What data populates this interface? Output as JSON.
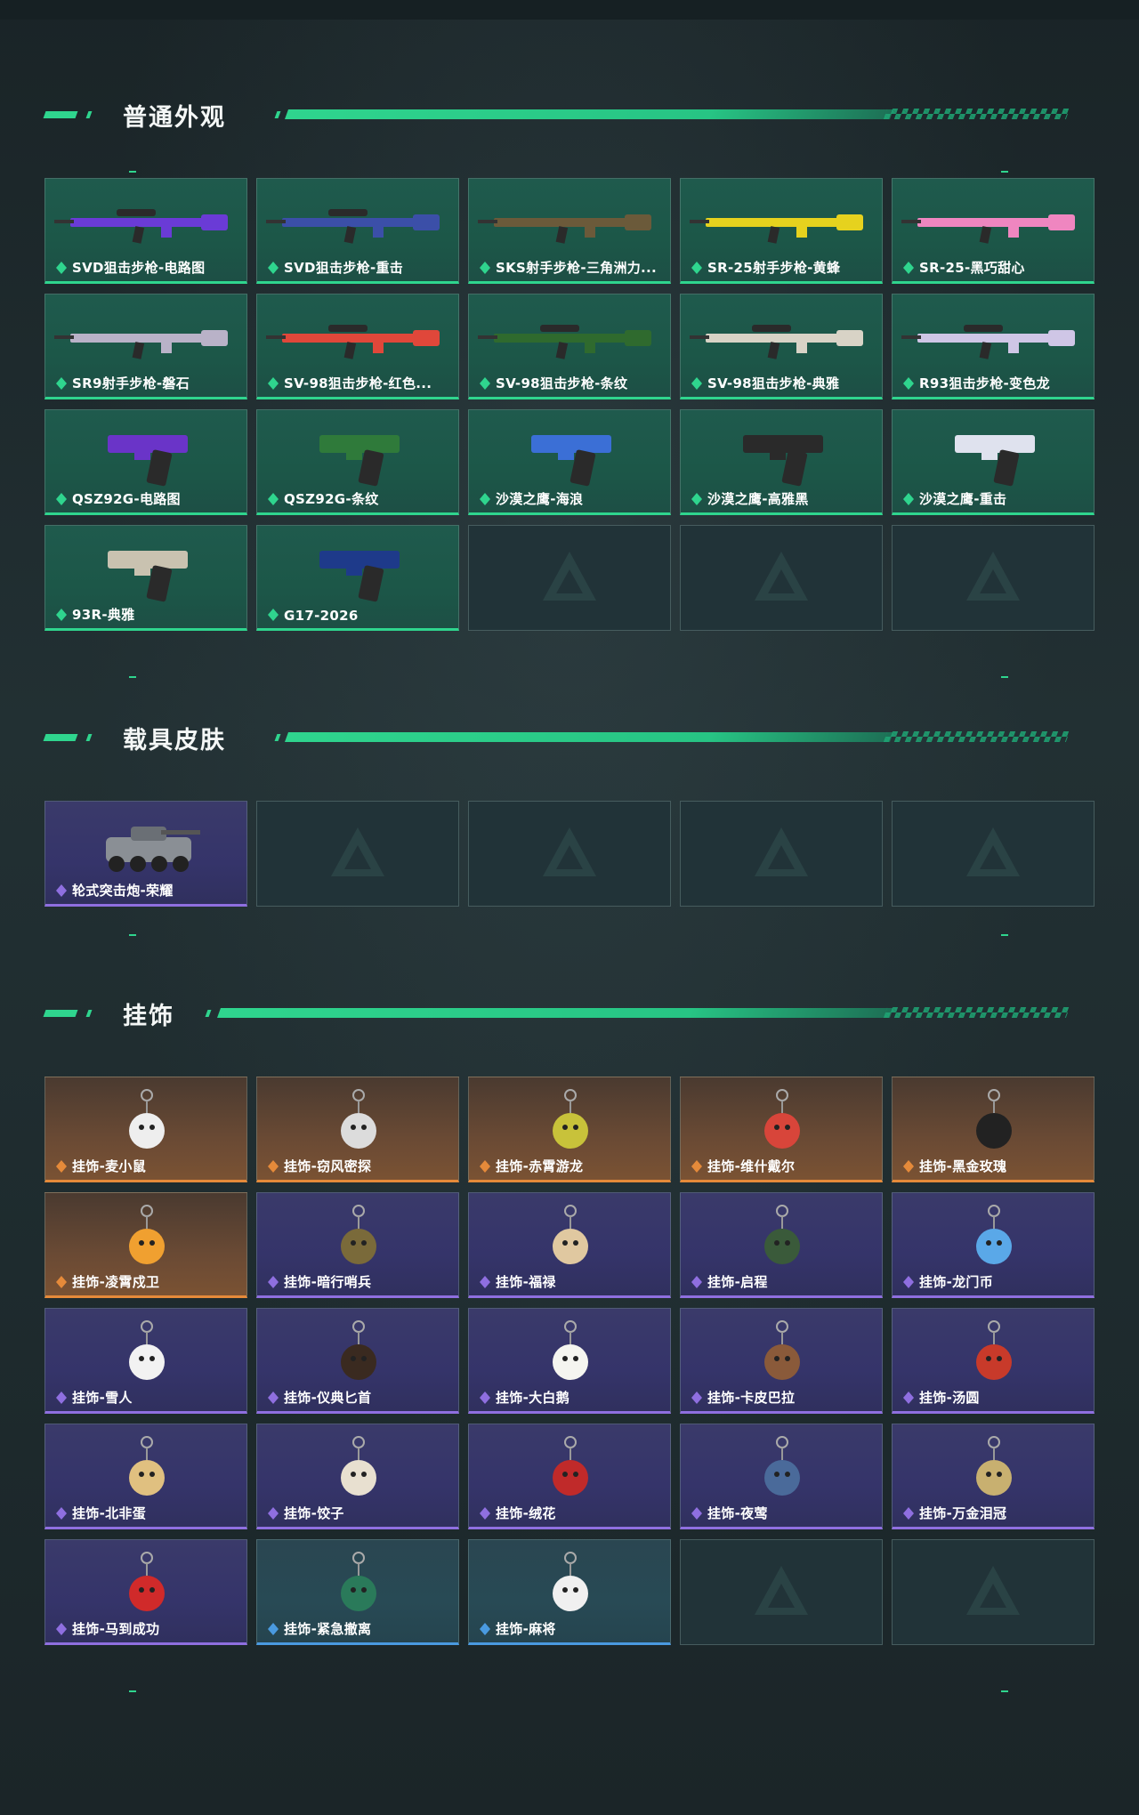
{
  "sections": [
    {
      "title": "普通外观",
      "items": [
        {
          "name": "SVD狙击步枪-电路图",
          "rarity": "green",
          "icon": "sniper-rifle-icon",
          "color": "#6a3bd6"
        },
        {
          "name": "SVD狙击步枪-重击",
          "rarity": "green",
          "icon": "sniper-rifle-icon",
          "color": "#3b4fa8"
        },
        {
          "name": "SKS射手步枪-三角洲力...",
          "rarity": "green",
          "icon": "rifle-icon",
          "color": "#6b5a3a"
        },
        {
          "name": "SR-25射手步枪-黄蜂",
          "rarity": "green",
          "icon": "rifle-icon",
          "color": "#e6d21e"
        },
        {
          "name": "SR-25-黑巧甜心",
          "rarity": "green",
          "icon": "rifle-icon",
          "color": "#ef86c0"
        },
        {
          "name": "SR9射手步枪-磐石",
          "rarity": "green",
          "icon": "rifle-icon",
          "color": "#b9b2c8"
        },
        {
          "name": "SV-98狙击步枪-红色...",
          "rarity": "green",
          "icon": "sniper-rifle-icon",
          "color": "#e0473a"
        },
        {
          "name": "SV-98狙击步枪-条纹",
          "rarity": "green",
          "icon": "sniper-rifle-icon",
          "color": "#2f6a2e"
        },
        {
          "name": "SV-98狙击步枪-典雅",
          "rarity": "green",
          "icon": "sniper-rifle-icon",
          "color": "#d8d3c6"
        },
        {
          "name": "R93狙击步枪-变色龙",
          "rarity": "green",
          "icon": "sniper-rifle-icon",
          "color": "#cfc6e6"
        },
        {
          "name": "QSZ92G-电路图",
          "rarity": "green",
          "icon": "pistol-icon",
          "color": "#6a34c8"
        },
        {
          "name": "QSZ92G-条纹",
          "rarity": "green",
          "icon": "pistol-icon",
          "color": "#2f7a3a"
        },
        {
          "name": "沙漠之鹰-海浪",
          "rarity": "green",
          "icon": "pistol-icon",
          "color": "#3b6fd6"
        },
        {
          "name": "沙漠之鹰-高雅黑",
          "rarity": "green",
          "icon": "pistol-icon",
          "color": "#2a2a2a"
        },
        {
          "name": "沙漠之鹰-重击",
          "rarity": "green",
          "icon": "pistol-icon",
          "color": "#dfe2ee"
        },
        {
          "name": "93R-典雅",
          "rarity": "green",
          "icon": "pistol-icon",
          "color": "#c9c2b0"
        },
        {
          "name": "G17-2026",
          "rarity": "green",
          "icon": "pistol-icon",
          "color": "#1e3a8a"
        },
        {
          "name": "",
          "rarity": "empty",
          "icon": "logo-watermark-icon",
          "color": ""
        },
        {
          "name": "",
          "rarity": "empty",
          "icon": "logo-watermark-icon",
          "color": ""
        },
        {
          "name": "",
          "rarity": "empty",
          "icon": "logo-watermark-icon",
          "color": ""
        }
      ]
    },
    {
      "title": "载具皮肤",
      "items": [
        {
          "name": "轮式突击炮-荣耀",
          "rarity": "purple",
          "icon": "armored-vehicle-icon",
          "color": "#8a8f95"
        },
        {
          "name": "",
          "rarity": "empty",
          "icon": "logo-watermark-icon",
          "color": ""
        },
        {
          "name": "",
          "rarity": "empty",
          "icon": "logo-watermark-icon",
          "color": ""
        },
        {
          "name": "",
          "rarity": "empty",
          "icon": "logo-watermark-icon",
          "color": ""
        },
        {
          "name": "",
          "rarity": "empty",
          "icon": "logo-watermark-icon",
          "color": ""
        }
      ]
    },
    {
      "title": "挂饰",
      "items": [
        {
          "name": "挂饰-麦小鼠",
          "rarity": "orange",
          "icon": "charm-icon",
          "color": "#eeeeee"
        },
        {
          "name": "挂饰-窃风密探",
          "rarity": "orange",
          "icon": "charm-icon",
          "color": "#dcdcdc"
        },
        {
          "name": "挂饰-赤霄游龙",
          "rarity": "orange",
          "icon": "charm-icon",
          "color": "#c8c23a"
        },
        {
          "name": "挂饰-维什戴尔",
          "rarity": "orange",
          "icon": "charm-icon",
          "color": "#d8453a"
        },
        {
          "name": "挂饰-黑金玫瑰",
          "rarity": "orange",
          "icon": "charm-icon",
          "color": "#222222"
        },
        {
          "name": "挂饰-凌霄戍卫",
          "rarity": "orange",
          "icon": "charm-icon",
          "color": "#f0a030"
        },
        {
          "name": "挂饰-暗行哨兵",
          "rarity": "purple",
          "icon": "charm-icon",
          "color": "#7a6a3a"
        },
        {
          "name": "挂饰-福禄",
          "rarity": "purple",
          "icon": "charm-icon",
          "color": "#e0c8a0"
        },
        {
          "name": "挂饰-启程",
          "rarity": "purple",
          "icon": "charm-icon",
          "color": "#3a5a3a"
        },
        {
          "name": "挂饰-龙门币",
          "rarity": "purple",
          "icon": "charm-icon",
          "color": "#5aa8e8"
        },
        {
          "name": "挂饰-雪人",
          "rarity": "purple",
          "icon": "charm-icon",
          "color": "#f2f2f2"
        },
        {
          "name": "挂饰-仪典匕首",
          "rarity": "purple",
          "icon": "charm-icon",
          "color": "#3a2a20"
        },
        {
          "name": "挂饰-大白鹅",
          "rarity": "purple",
          "icon": "charm-icon",
          "color": "#f5f5f0"
        },
        {
          "name": "挂饰-卡皮巴拉",
          "rarity": "purple",
          "icon": "charm-icon",
          "color": "#8a5a3a"
        },
        {
          "name": "挂饰-汤圆",
          "rarity": "purple",
          "icon": "charm-icon",
          "color": "#c83a2a"
        },
        {
          "name": "挂饰-北非蛋",
          "rarity": "purple",
          "icon": "charm-icon",
          "color": "#e0c080"
        },
        {
          "name": "挂饰-饺子",
          "rarity": "purple",
          "icon": "charm-icon",
          "color": "#e8e0d0"
        },
        {
          "name": "挂饰-绒花",
          "rarity": "purple",
          "icon": "charm-icon",
          "color": "#c02a2a"
        },
        {
          "name": "挂饰-夜莺",
          "rarity": "purple",
          "icon": "charm-icon",
          "color": "#4a6a9a"
        },
        {
          "name": "挂饰-万金泪冠",
          "rarity": "purple",
          "icon": "charm-icon",
          "color": "#c8b070"
        },
        {
          "name": "挂饰-马到成功",
          "rarity": "purple",
          "icon": "charm-icon",
          "color": "#d02a2a"
        },
        {
          "name": "挂饰-紧急撤离",
          "rarity": "blue",
          "icon": "charm-icon",
          "color": "#2a7a5a"
        },
        {
          "name": "挂饰-麻将",
          "rarity": "blue",
          "icon": "charm-icon",
          "color": "#f0f0f0"
        },
        {
          "name": "",
          "rarity": "empty",
          "icon": "logo-watermark-icon",
          "color": ""
        },
        {
          "name": "",
          "rarity": "empty",
          "icon": "logo-watermark-icon",
          "color": ""
        }
      ]
    }
  ],
  "colors": {
    "accent": "#2fd58e",
    "rarity_green": "#2fd58e",
    "rarity_purple": "#8f6fe0",
    "rarity_orange": "#e58a3a",
    "rarity_blue": "#4a9ae0"
  }
}
